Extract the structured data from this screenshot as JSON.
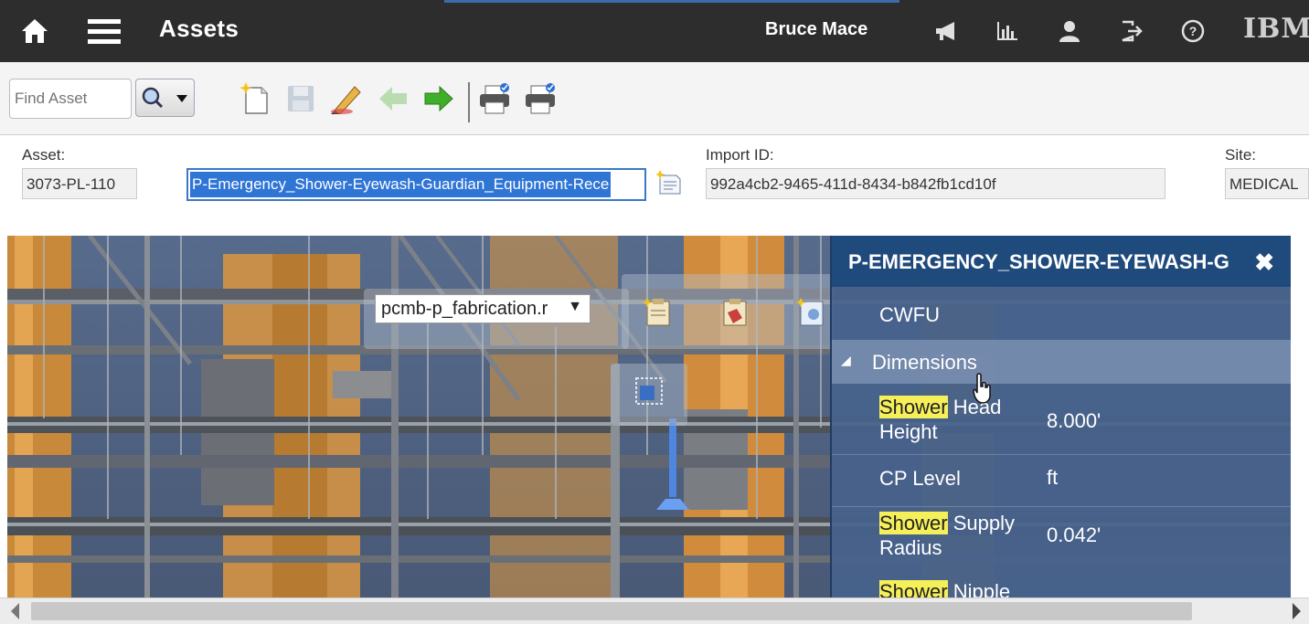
{
  "colors": {
    "topbar": "#2d2d2d",
    "selection": "#2f75d6",
    "highlight": "#f5ef5a",
    "panel_header": "#1f4a7c"
  },
  "topbar": {
    "title": "Assets",
    "user": "Bruce Mace",
    "brand": "IBM",
    "icons": [
      "home-icon",
      "menu-icon",
      "bulletin-icon",
      "reports-icon",
      "profile-icon",
      "signout-icon",
      "help-icon"
    ]
  },
  "toolbar": {
    "find_placeholder": "Find Asset",
    "icons": [
      "new-record-icon",
      "save-icon",
      "edit-icon",
      "previous-icon",
      "next-icon",
      "print-icon",
      "print-attachments-icon"
    ]
  },
  "fields": {
    "asset_label": "Asset:",
    "asset_value": "3073-PL-110",
    "description_value": "P-Emergency_Shower-Eyewash-Guardian_Equipment-Rece",
    "import_label": "Import ID:",
    "import_value": "992a4cb2-9465-411d-8434-b842fb1cd10f",
    "site_label": "Site:",
    "site_value": "MEDICAL"
  },
  "viewer": {
    "model_select": "pcmb-p_fabrication.r"
  },
  "properties": {
    "title": "P-EMERGENCY_SHOWER-EYEWASH-G",
    "close": "✖",
    "group_cwfu": "CWFU",
    "section": "Dimensions",
    "rows": [
      {
        "highlight": "Shower",
        "rest": " Head",
        "line2": "Height",
        "value": "8.000'"
      },
      {
        "highlight": "",
        "rest": "CP Level",
        "line2": "",
        "value": "ft"
      },
      {
        "highlight": "Shower",
        "rest": " Supply",
        "line2": "Radius",
        "value": "0.042'"
      },
      {
        "highlight": "Shower",
        "rest": " Nipple",
        "line2": "",
        "value": ""
      }
    ]
  }
}
